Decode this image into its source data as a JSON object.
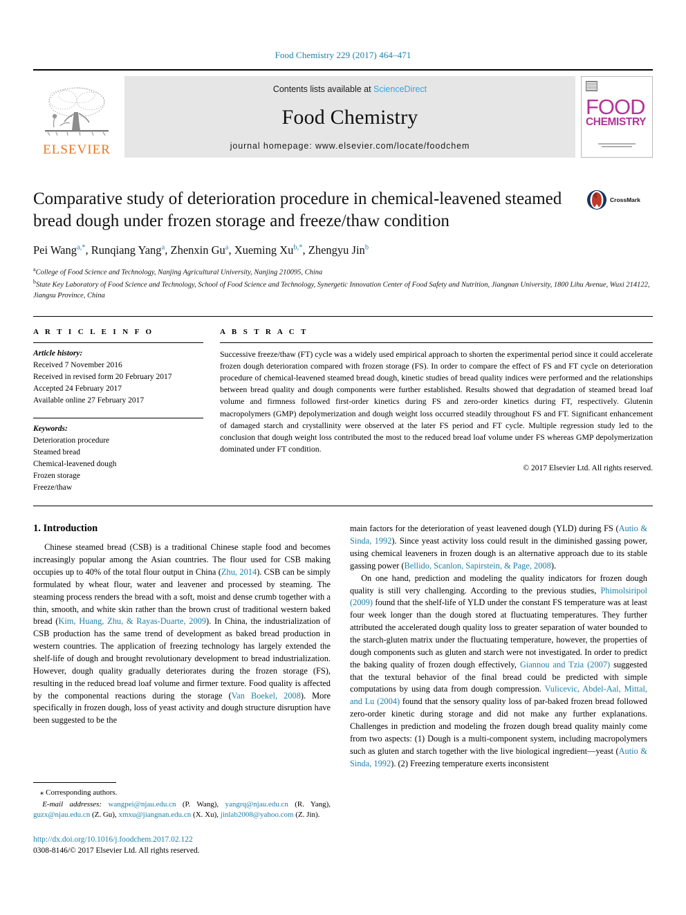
{
  "running_head": "Food Chemistry 229 (2017) 464–471",
  "masthead": {
    "publisher_name": "ELSEVIER",
    "contents_prefix": "Contents lists available at ",
    "contents_link": "ScienceDirect",
    "journal_name": "Food Chemistry",
    "homepage": "journal homepage: www.elsevier.com/locate/foodchem",
    "cover": {
      "line1": "FOOD",
      "line2": "CHEMISTRY"
    }
  },
  "article": {
    "title": "Comparative study of deterioration procedure in chemical-leavened steamed bread dough under frozen storage and freeze/thaw condition",
    "crossmark_label": "CrossMark",
    "authors": [
      {
        "name": "Pei Wang",
        "sup": "a,*",
        "sep": ", "
      },
      {
        "name": "Runqiang Yang",
        "sup": "a",
        "sep": ", "
      },
      {
        "name": "Zhenxin Gu",
        "sup": "a",
        "sep": ", "
      },
      {
        "name": "Xueming Xu",
        "sup": "b,*",
        "sep": ", "
      },
      {
        "name": "Zhengyu Jin",
        "sup": "b",
        "sep": ""
      }
    ],
    "affiliations": [
      {
        "label": "a",
        "text": "College of Food Science and Technology, Nanjing Agricultural University, Nanjing 210095, China"
      },
      {
        "label": "b",
        "text": "State Key Laboratory of Food Science and Technology, School of Food Science and Technology, Synergetic Innovation Center of Food Safety and Nutrition, Jiangnan University, 1800 Lihu Avenue, Wuxi 214122, Jiangsu Province, China"
      }
    ]
  },
  "article_info": {
    "heading": "A R T I C L E    I N F O",
    "history_label": "Article history:",
    "history": [
      "Received 7 November 2016",
      "Received in revised form 20 February 2017",
      "Accepted 24 February 2017",
      "Available online 27 February 2017"
    ],
    "keywords_label": "Keywords:",
    "keywords": [
      "Deterioration procedure",
      "Steamed bread",
      "Chemical-leavened dough",
      "Frozen storage",
      "Freeze/thaw"
    ]
  },
  "abstract": {
    "heading": "A B S T R A C T",
    "text": "Successive freeze/thaw (FT) cycle was a widely used empirical approach to shorten the experimental period since it could accelerate frozen dough deterioration compared with frozen storage (FS). In order to compare the effect of FS and FT cycle on deterioration procedure of chemical-leavened steamed bread dough, kinetic studies of bread quality indices were performed and the relationships between bread quality and dough components were further established. Results showed that degradation of steamed bread loaf volume and firmness followed first-order kinetics during FS and zero-order kinetics during FT, respectively. Glutenin macropolymers (GMP) depolymerization and dough weight loss occurred steadily throughout FS and FT. Significant enhancement of damaged starch and crystallinity were observed at the later FS period and FT cycle. Multiple regression study led to the conclusion that dough weight loss contributed the most to the reduced bread loaf volume under FS whereas GMP depolymerization dominated under FT condition.",
    "copyright": "© 2017 Elsevier Ltd. All rights reserved."
  },
  "introduction": {
    "heading": "1. Introduction",
    "left_paragraph_html": "Chinese steamed bread (CSB) is a traditional Chinese staple food and becomes increasingly popular among the Asian countries. The flour used for CSB making occupies up to 40% of the total flour output in China (<span class=\"ref\">Zhu, 2014</span>). CSB can be simply formulated by wheat flour, water and leavener and processed by steaming. The steaming process renders the bread with a soft, moist and dense crumb together with a thin, smooth, and white skin rather than the brown crust of traditional western baked bread (<span class=\"ref\">Kim, Huang, Zhu, &amp; Rayas-Duarte, 2009</span>). In China, the industrialization of CSB production has the same trend of development as baked bread production in western countries. The application of freezing technology has largely extended the shelf-life of dough and brought revolutionary development to bread industrialization. However, dough quality gradually deteriorates during the frozen storage (FS), resulting in the reduced bread loaf volume and firmer texture. Food quality is affected by the componental reactions during the storage (<span class=\"ref\">Van Boekel, 2008</span>). More specifically in frozen dough, loss of yeast activity and dough structure disruption have been suggested to be the",
    "right_paragraph1_html": "main factors for the deterioration of yeast leavened dough (YLD) during FS (<span class=\"ref\">Autio &amp; Sinda, 1992</span>). Since yeast activity loss could result in the diminished gassing power, using chemical leaveners in frozen dough is an alternative approach due to its stable gassing power (<span class=\"ref\">Bellido, Scanlon, Sapirstein, &amp; Page, 2008</span>).",
    "right_paragraph2_html": "On one hand, prediction and modeling the quality indicators for frozen dough quality is still very challenging. According to the previous studies, <span class=\"ref\">Phimolsiripol (2009)</span> found that the shelf-life of YLD under the constant FS temperature was at least four week longer than the dough stored at fluctuating temperatures. They further attributed the accelerated dough quality loss to greater separation of water bounded to the starch-gluten matrix under the fluctuating temperature, however, the properties of dough components such as gluten and starch were not investigated. In order to predict the baking quality of frozen dough effectively, <span class=\"ref\">Giannou and Tzia (2007)</span> suggested that the textural behavior of the final bread could be predicted with simple computations by using data from dough compression. <span class=\"ref\">Vulicevic, Abdel-Aal, Mittal, and Lu (2004)</span> found that the sensory quality loss of par-baked frozen bread followed zero-order kinetic during storage and did not make any further explanations. Challenges in prediction and modeling the frozen dough bread quality mainly come from two aspects: (1) Dough is a multi-component system, including macropolymers such as gluten and starch together with the live biological ingredient—yeast (<span class=\"ref\">Autio &amp; Sinda, 1992</span>). (2) Freezing temperature exerts inconsistent"
  },
  "footnotes": {
    "corresponding": "Corresponding authors.",
    "corresponding_star": "⁎",
    "email_label": "E-mail addresses:",
    "emails_html": "<span class=\"ref\">wangpei@njau.edu.cn</span> (P. Wang), <span class=\"ref\">yangrq@njau.edu.cn</span> (R. Yang), <span class=\"ref\">guzx@njau.edu.cn</span> (Z. Gu), <span class=\"ref\">xmxu@jiangnan.edu.cn</span> (X. Xu), <span class=\"ref\">jinlab2008@yahoo.com</span> (Z. Jin).",
    "doi": "http://dx.doi.org/10.1016/j.foodchem.2017.02.122",
    "issn_line": "0308-8146/© 2017 Elsevier Ltd. All rights reserved."
  },
  "colors": {
    "link": "#1a7fa8",
    "sciencedirect": "#3aa3d6",
    "elsevier_orange": "#E87722",
    "cover_magenta": "#b4339a",
    "masthead_grey": "#e6e6e6"
  }
}
